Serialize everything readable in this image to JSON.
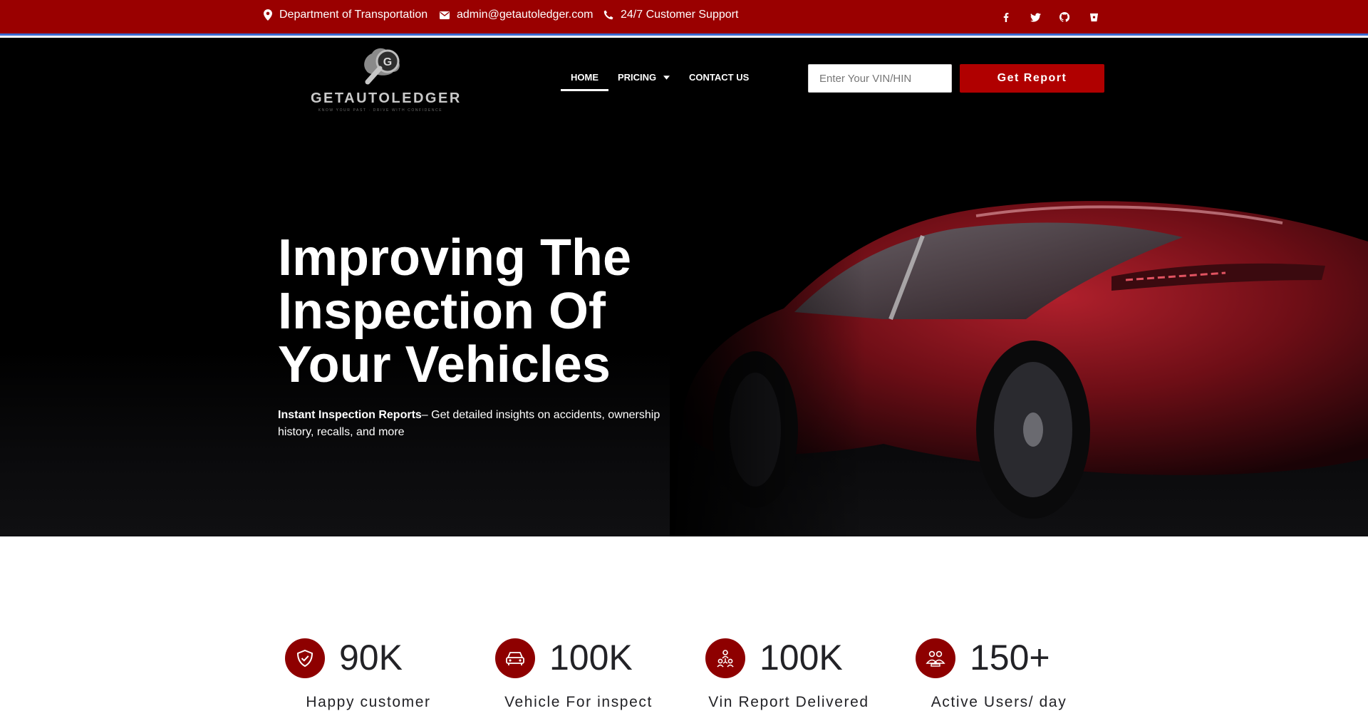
{
  "topbar": {
    "location": "Department of Transportation",
    "email": "admin@getautoledger.com",
    "support": "24/7 Customer Support",
    "social_icons": [
      "facebook-icon",
      "twitter-icon",
      "github-icon",
      "bitbucket-icon"
    ]
  },
  "brand": {
    "name": "GETAUTOLEDGER",
    "tagline": "KNOW YOUR PAST · DRIVE WITH CONFIDENCE",
    "logo_letter": "G"
  },
  "nav": {
    "items": [
      {
        "label": "HOME",
        "active": true
      },
      {
        "label": "PRICING",
        "has_dropdown": true
      },
      {
        "label": "CONTACT US"
      }
    ]
  },
  "search": {
    "placeholder": "Enter Your VIN/HIN",
    "value": "",
    "button_label": "Get Report"
  },
  "hero": {
    "title_lines": [
      "Improving The",
      "Inspection Of",
      "Your Vehicles"
    ],
    "subtitle_bold": "Instant Inspection Reports",
    "subtitle_rest": "– Get detailed insights on accidents, ownership history, recalls, and more"
  },
  "stats": [
    {
      "icon": "shield-check-icon",
      "value": "90K",
      "label": "Happy customer"
    },
    {
      "icon": "car-icon",
      "value": "100K",
      "label": "Vehicle For inspect"
    },
    {
      "icon": "team-icon",
      "value": "100K",
      "label": "Vin Report Delivered"
    },
    {
      "icon": "users-icon",
      "value": "150+",
      "label": "Active Users/ day"
    }
  ],
  "colors": {
    "topbar_bg": "#9a0000",
    "topbar_border": "#3a6ad0",
    "header_bg": "#000000",
    "accent_button": "#b00000",
    "stat_icon_bg": "#8e0000",
    "car_body": "#8a1018"
  }
}
